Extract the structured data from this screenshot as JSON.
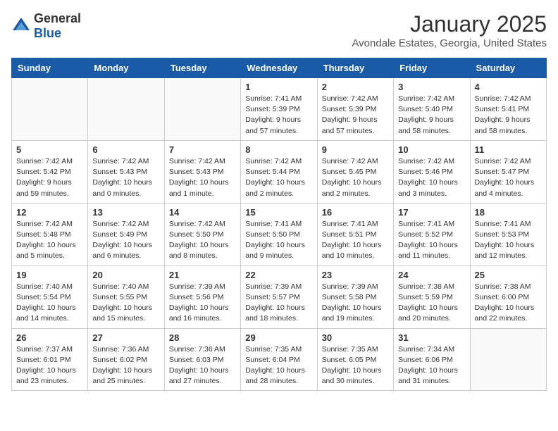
{
  "logo": {
    "general": "General",
    "blue": "Blue"
  },
  "header": {
    "title": "January 2025",
    "subtitle": "Avondale Estates, Georgia, United States"
  },
  "days_of_week": [
    "Sunday",
    "Monday",
    "Tuesday",
    "Wednesday",
    "Thursday",
    "Friday",
    "Saturday"
  ],
  "weeks": [
    [
      {
        "day": "",
        "info": ""
      },
      {
        "day": "",
        "info": ""
      },
      {
        "day": "",
        "info": ""
      },
      {
        "day": "1",
        "info": "Sunrise: 7:41 AM\nSunset: 5:39 PM\nDaylight: 9 hours and 57 minutes."
      },
      {
        "day": "2",
        "info": "Sunrise: 7:42 AM\nSunset: 5:39 PM\nDaylight: 9 hours and 57 minutes."
      },
      {
        "day": "3",
        "info": "Sunrise: 7:42 AM\nSunset: 5:40 PM\nDaylight: 9 hours and 58 minutes."
      },
      {
        "day": "4",
        "info": "Sunrise: 7:42 AM\nSunset: 5:41 PM\nDaylight: 9 hours and 58 minutes."
      }
    ],
    [
      {
        "day": "5",
        "info": "Sunrise: 7:42 AM\nSunset: 5:42 PM\nDaylight: 9 hours and 59 minutes."
      },
      {
        "day": "6",
        "info": "Sunrise: 7:42 AM\nSunset: 5:43 PM\nDaylight: 10 hours and 0 minutes."
      },
      {
        "day": "7",
        "info": "Sunrise: 7:42 AM\nSunset: 5:43 PM\nDaylight: 10 hours and 1 minute."
      },
      {
        "day": "8",
        "info": "Sunrise: 7:42 AM\nSunset: 5:44 PM\nDaylight: 10 hours and 2 minutes."
      },
      {
        "day": "9",
        "info": "Sunrise: 7:42 AM\nSunset: 5:45 PM\nDaylight: 10 hours and 2 minutes."
      },
      {
        "day": "10",
        "info": "Sunrise: 7:42 AM\nSunset: 5:46 PM\nDaylight: 10 hours and 3 minutes."
      },
      {
        "day": "11",
        "info": "Sunrise: 7:42 AM\nSunset: 5:47 PM\nDaylight: 10 hours and 4 minutes."
      }
    ],
    [
      {
        "day": "12",
        "info": "Sunrise: 7:42 AM\nSunset: 5:48 PM\nDaylight: 10 hours and 5 minutes."
      },
      {
        "day": "13",
        "info": "Sunrise: 7:42 AM\nSunset: 5:49 PM\nDaylight: 10 hours and 6 minutes."
      },
      {
        "day": "14",
        "info": "Sunrise: 7:42 AM\nSunset: 5:50 PM\nDaylight: 10 hours and 8 minutes."
      },
      {
        "day": "15",
        "info": "Sunrise: 7:41 AM\nSunset: 5:50 PM\nDaylight: 10 hours and 9 minutes."
      },
      {
        "day": "16",
        "info": "Sunrise: 7:41 AM\nSunset: 5:51 PM\nDaylight: 10 hours and 10 minutes."
      },
      {
        "day": "17",
        "info": "Sunrise: 7:41 AM\nSunset: 5:52 PM\nDaylight: 10 hours and 11 minutes."
      },
      {
        "day": "18",
        "info": "Sunrise: 7:41 AM\nSunset: 5:53 PM\nDaylight: 10 hours and 12 minutes."
      }
    ],
    [
      {
        "day": "19",
        "info": "Sunrise: 7:40 AM\nSunset: 5:54 PM\nDaylight: 10 hours and 14 minutes."
      },
      {
        "day": "20",
        "info": "Sunrise: 7:40 AM\nSunset: 5:55 PM\nDaylight: 10 hours and 15 minutes."
      },
      {
        "day": "21",
        "info": "Sunrise: 7:39 AM\nSunset: 5:56 PM\nDaylight: 10 hours and 16 minutes."
      },
      {
        "day": "22",
        "info": "Sunrise: 7:39 AM\nSunset: 5:57 PM\nDaylight: 10 hours and 18 minutes."
      },
      {
        "day": "23",
        "info": "Sunrise: 7:39 AM\nSunset: 5:58 PM\nDaylight: 10 hours and 19 minutes."
      },
      {
        "day": "24",
        "info": "Sunrise: 7:38 AM\nSunset: 5:59 PM\nDaylight: 10 hours and 20 minutes."
      },
      {
        "day": "25",
        "info": "Sunrise: 7:38 AM\nSunset: 6:00 PM\nDaylight: 10 hours and 22 minutes."
      }
    ],
    [
      {
        "day": "26",
        "info": "Sunrise: 7:37 AM\nSunset: 6:01 PM\nDaylight: 10 hours and 23 minutes."
      },
      {
        "day": "27",
        "info": "Sunrise: 7:36 AM\nSunset: 6:02 PM\nDaylight: 10 hours and 25 minutes."
      },
      {
        "day": "28",
        "info": "Sunrise: 7:36 AM\nSunset: 6:03 PM\nDaylight: 10 hours and 27 minutes."
      },
      {
        "day": "29",
        "info": "Sunrise: 7:35 AM\nSunset: 6:04 PM\nDaylight: 10 hours and 28 minutes."
      },
      {
        "day": "30",
        "info": "Sunrise: 7:35 AM\nSunset: 6:05 PM\nDaylight: 10 hours and 30 minutes."
      },
      {
        "day": "31",
        "info": "Sunrise: 7:34 AM\nSunset: 6:06 PM\nDaylight: 10 hours and 31 minutes."
      },
      {
        "day": "",
        "info": ""
      }
    ]
  ]
}
